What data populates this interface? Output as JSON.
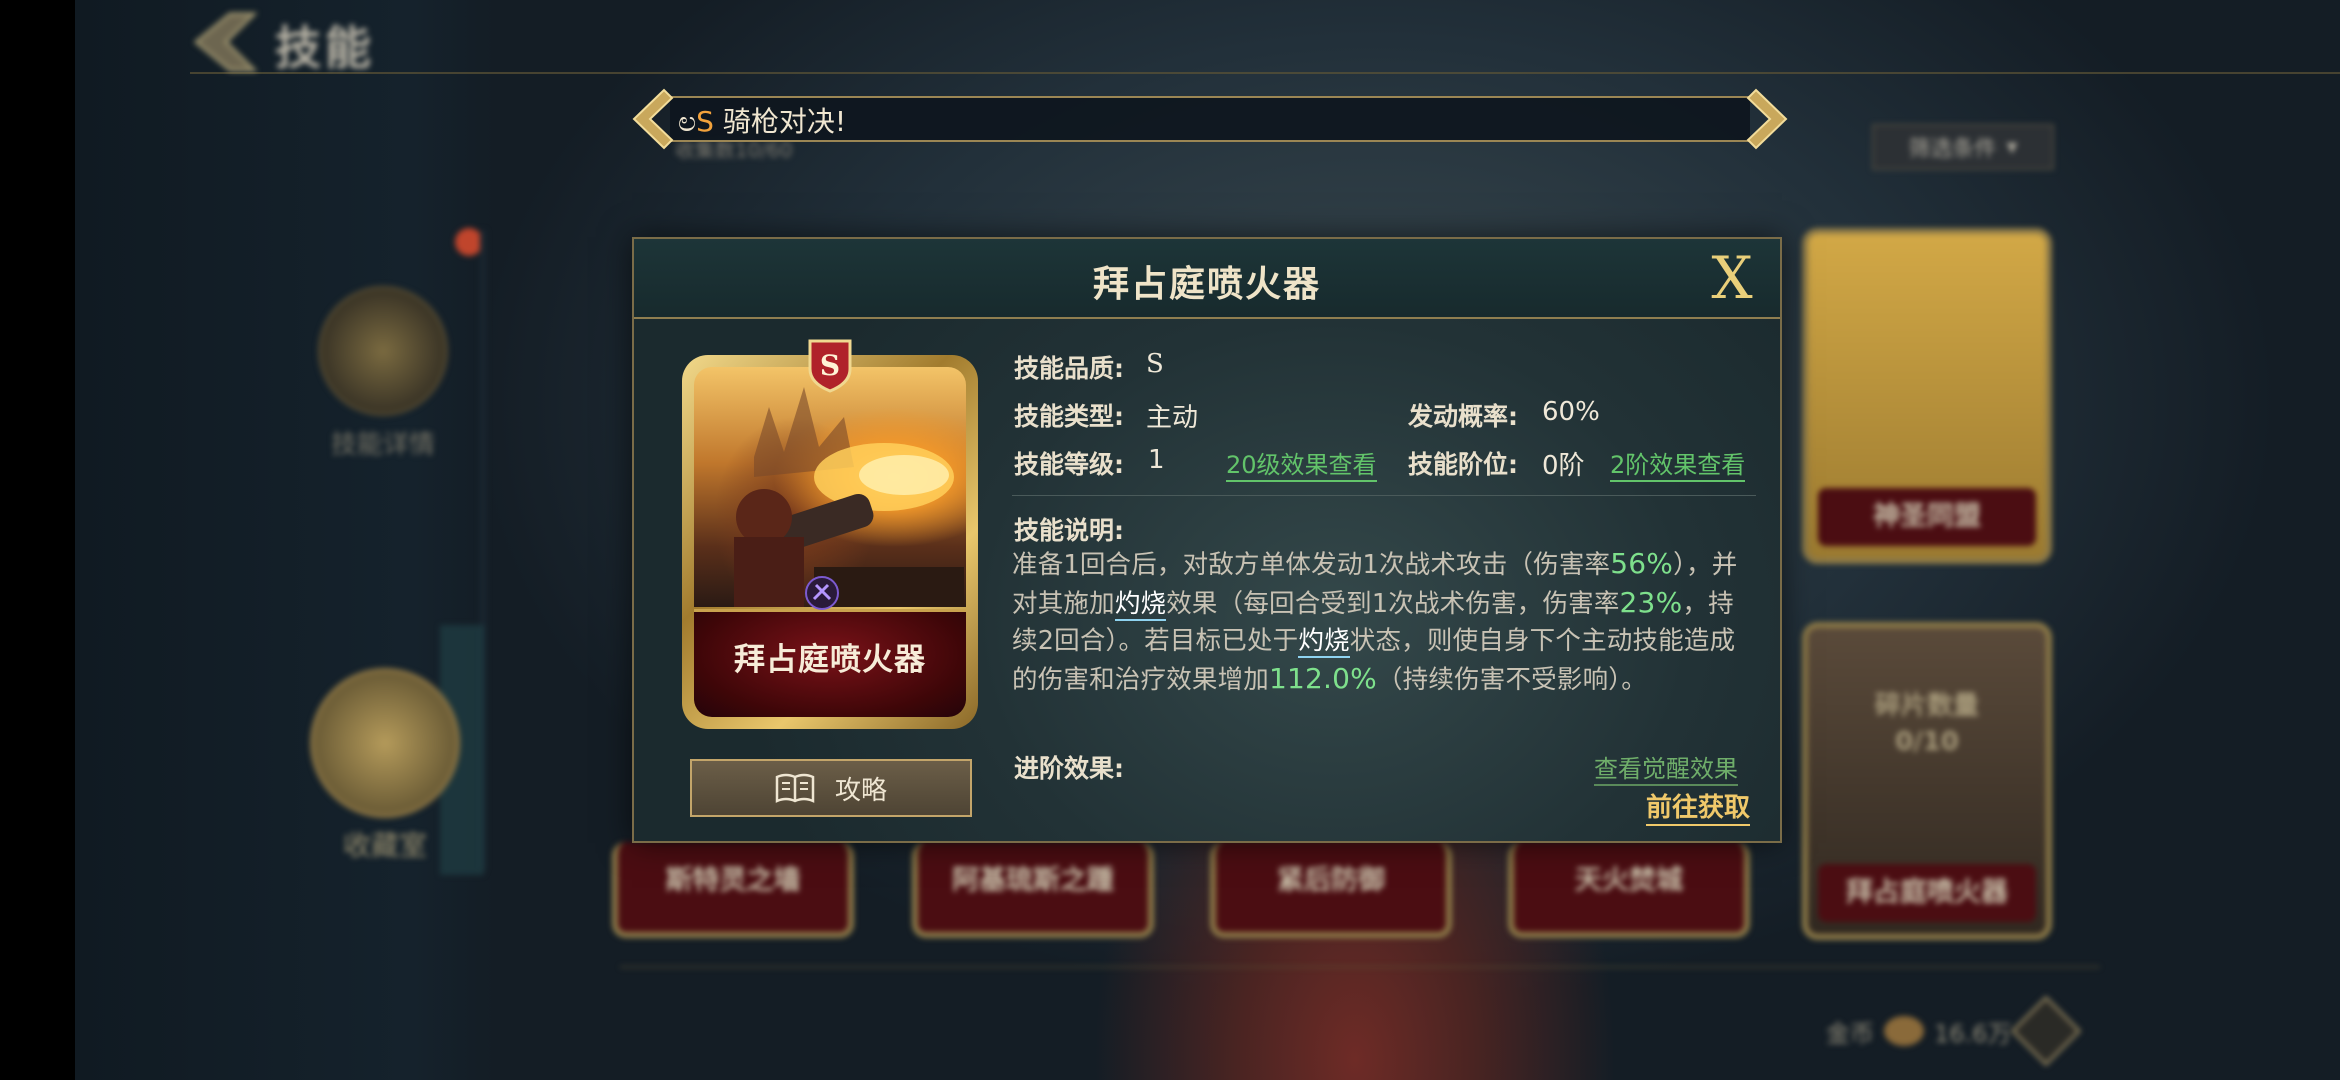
{
  "header": {
    "title": "技能"
  },
  "background": {
    "sub_label": "收集数10/60",
    "filter_label": "筛选条件",
    "side_items": [
      "技能详情",
      "收藏室"
    ],
    "grid_cards": [
      {
        "label": "神圣同盟"
      },
      {
        "label": "拜占庭喷火器",
        "shards": "碎片数量",
        "shard_count": "0/10"
      }
    ],
    "bottom_cards": [
      "斯特灵之墙",
      "阿基琉斯之踵",
      "紧后防御",
      "天火焚城"
    ],
    "currency_label": "金币",
    "currency_value": "16.6万"
  },
  "banner": {
    "prefix": "ಲ",
    "quality": "S",
    "text": " 骑枪对决!"
  },
  "dialog": {
    "title": "拜占庭喷火器",
    "close_label": "X",
    "card_name": "拜占庭喷火器",
    "card_quality": "S",
    "guide_label": "攻略",
    "labels": {
      "quality": "技能品质:",
      "type": "技能类型:",
      "level": "技能等级:",
      "chance": "发动概率:",
      "stage": "技能阶位:",
      "description": "技能说明:",
      "advance": "进阶效果:"
    },
    "values": {
      "quality": "S",
      "type": "主动",
      "level": "1",
      "chance": "60%",
      "stage": "0阶"
    },
    "links": {
      "level_effect": "20级效果查看",
      "stage_effect": "2阶效果查看",
      "awaken_effect": "查看觉醒效果",
      "goto": "前往获取"
    },
    "description": {
      "p1": "准备1回合后，对敌方单体发动1次战术攻击（伤害率",
      "n1": "56%",
      "p2": "），并对其施加",
      "k1": "灼烧",
      "p3": "效果（每回合受到1次战术伤害，伤害率",
      "n2": "23%",
      "p4": "，持续2回合）。若目标已处于",
      "k2": "灼烧",
      "p5": "状态，则使自身下个主动技能造成的伤害和治疗效果增加",
      "n3": "112.0%",
      "p6": "（持续伤害不受影响）。"
    }
  },
  "colors": {
    "accent_gold": "#e9cf7a",
    "link_green": "#62c46a",
    "number_green": "#7ee08c",
    "card_red": "#4b0d12"
  }
}
